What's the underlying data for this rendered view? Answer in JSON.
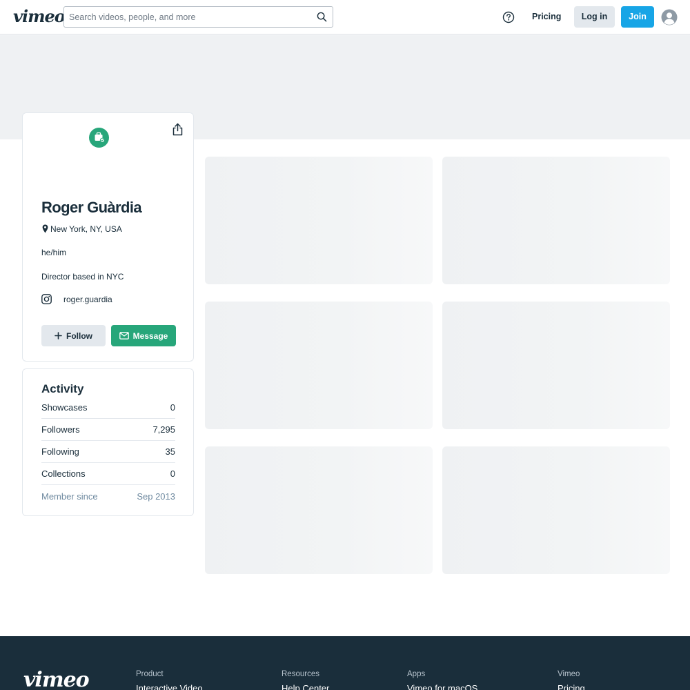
{
  "header": {
    "logo": "vimeo",
    "search_placeholder": "Search videos, people, and more",
    "pricing": "Pricing",
    "login": "Log in",
    "join": "Join"
  },
  "profile": {
    "name": "Roger Guàrdia",
    "location": "New York, NY, USA",
    "pronouns": "he/him",
    "bio": "Director based in NYC",
    "instagram": "roger.guardia",
    "follow_label": "Follow",
    "message_label": "Message"
  },
  "activity": {
    "title": "Activity",
    "stats": [
      {
        "label": "Showcases",
        "value": "0"
      },
      {
        "label": "Followers",
        "value": "7,295"
      },
      {
        "label": "Following",
        "value": "35"
      },
      {
        "label": "Collections",
        "value": "0"
      },
      {
        "label": "Member since",
        "value": "Sep 2013"
      }
    ]
  },
  "footer": {
    "logo": "vimeo",
    "columns": [
      {
        "heading": "Product",
        "link": "Interactive Video"
      },
      {
        "heading": "Resources",
        "link": "Help Center"
      },
      {
        "heading": "Apps",
        "link": "Vimeo for macOS"
      },
      {
        "heading": "Vimeo",
        "link": "Pricing"
      }
    ]
  },
  "colors": {
    "brand_blue": "#17a5e6",
    "green": "#27a67a",
    "dark": "#1a2e3b",
    "placeholder": "#eff1f3"
  }
}
